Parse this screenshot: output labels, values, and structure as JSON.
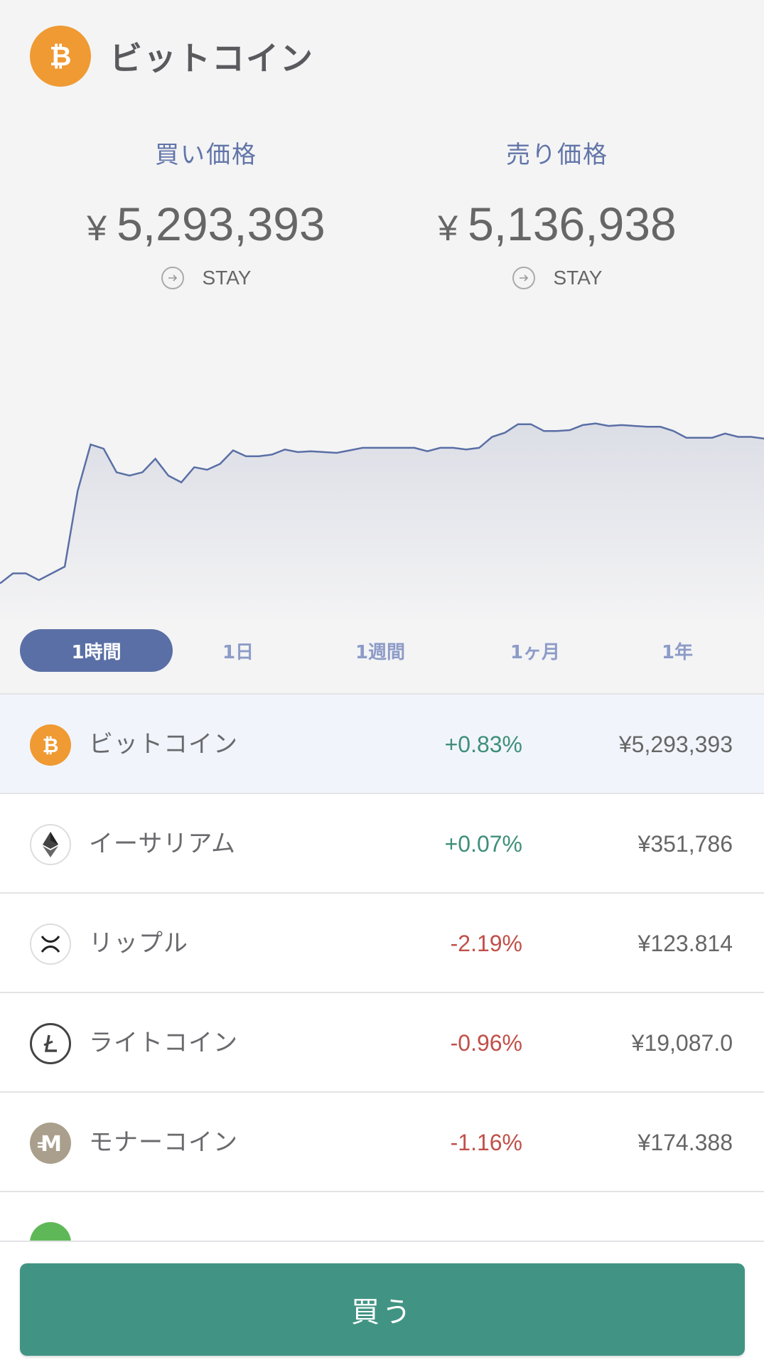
{
  "header": {
    "title": "ビットコイン",
    "buy": {
      "label": "買い価格",
      "currency": "¥",
      "value": "5,293,393",
      "status": "STAY"
    },
    "sell": {
      "label": "売り価格",
      "currency": "¥",
      "value": "5,136,938",
      "status": "STAY"
    }
  },
  "chart_data": {
    "type": "area",
    "title": "",
    "xlabel": "",
    "ylabel": "",
    "series": [
      {
        "values": [
          580,
          592,
          592,
          584,
          592,
          600,
          690,
          745,
          740,
          712,
          708,
          712,
          728,
          708,
          700,
          718,
          715,
          722,
          738,
          731,
          731,
          733,
          739,
          736,
          737,
          736,
          735,
          738,
          741,
          741,
          741,
          741,
          741,
          737,
          741,
          741,
          739,
          741,
          754,
          759,
          769,
          769,
          761,
          761,
          762,
          768,
          770,
          767,
          768,
          767,
          766,
          766,
          761,
          753,
          753,
          753,
          758,
          754,
          754,
          752
        ]
      }
    ],
    "grid": false,
    "colors": {
      "line": "#5a6fa5",
      "fill_top": "#dcdee6",
      "fill_bottom": "#f4f4f5"
    }
  },
  "ranges": [
    "1時間",
    "1日",
    "1週間",
    "1ヶ月",
    "1年"
  ],
  "active_range": "1時間",
  "coins": [
    {
      "name": "ビットコイン",
      "change": "+0.83%",
      "direction": "up",
      "price": "¥5,293,393",
      "icon": "bitcoin-icon"
    },
    {
      "name": "イーサリアム",
      "change": "+0.07%",
      "direction": "up",
      "price": "¥351,786",
      "icon": "ethereum-icon"
    },
    {
      "name": "リップル",
      "change": "-2.19%",
      "direction": "down",
      "price": "¥123.814",
      "icon": "ripple-icon"
    },
    {
      "name": "ライトコイン",
      "change": "-0.96%",
      "direction": "down",
      "price": "¥19,087.0",
      "icon": "litecoin-icon"
    },
    {
      "name": "モナーコイン",
      "change": "-1.16%",
      "direction": "down",
      "price": "¥174.388",
      "icon": "monacoin-icon"
    }
  ],
  "action": {
    "buy_label": "買う"
  },
  "colors": {
    "bitcoin": "#ef9a33",
    "accent": "#5a6fa5",
    "up": "#3f8f7a",
    "down": "#c0504a",
    "button": "#419484"
  }
}
